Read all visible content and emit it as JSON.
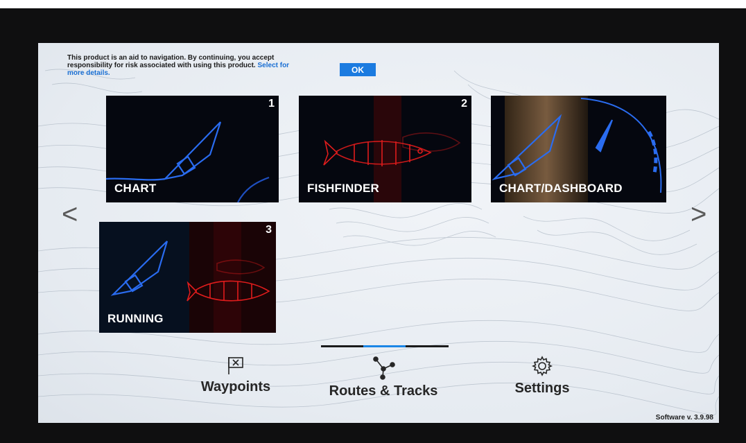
{
  "disclaimer": {
    "text": "This product is an aid to navigation. By continuing, you accept responsibility for risk associated with using this product.",
    "link": "Select for more details.",
    "ok_label": "OK"
  },
  "tiles": [
    {
      "label": "CHART",
      "number": "1"
    },
    {
      "label": "FISHFINDER",
      "number": "2"
    },
    {
      "label": "CHART/DASHBOARD",
      "number": ""
    },
    {
      "label": "RUNNING",
      "number": "3"
    }
  ],
  "nav": {
    "prev": "<",
    "next": ">"
  },
  "bottom": {
    "waypoints": {
      "label": "Waypoints",
      "icon": "flag-x-icon"
    },
    "routes": {
      "label": "Routes & Tracks",
      "icon": "route-nodes-icon"
    },
    "settings": {
      "label": "Settings",
      "icon": "gear-icon"
    }
  },
  "software": "Software v. 3.9.98",
  "colors": {
    "accent": "#1b7be0",
    "fish": "#e01c1c",
    "boat": "#2a6cf0"
  }
}
